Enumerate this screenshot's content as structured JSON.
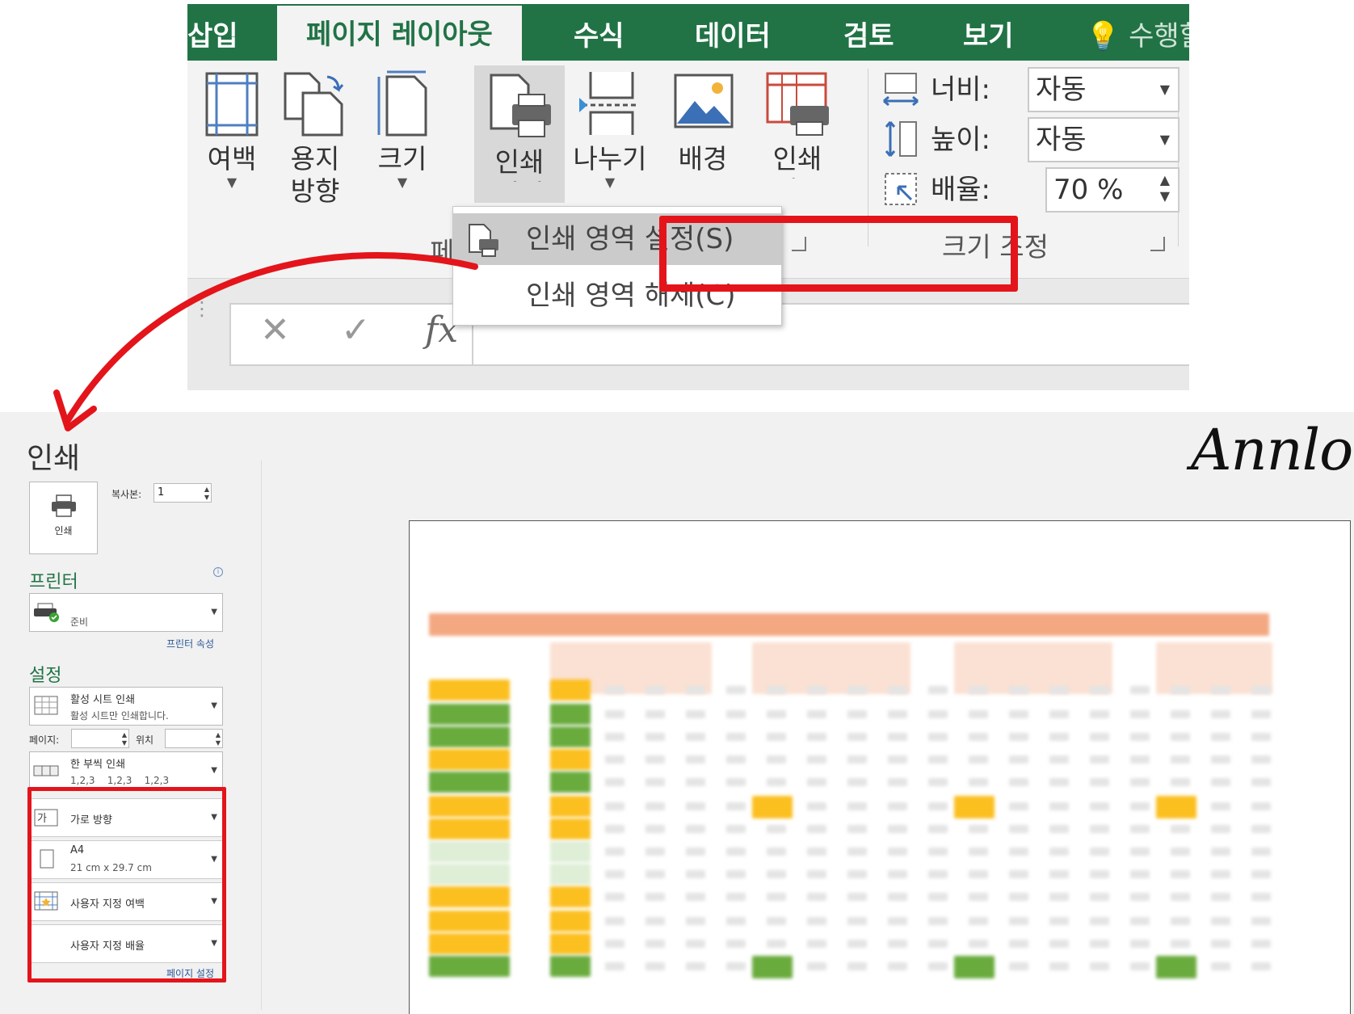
{
  "ribbon": {
    "tabs": [
      "삽입",
      "페이지 레이아웃",
      "수식",
      "데이터",
      "검토",
      "보기",
      "수행할"
    ],
    "active_tab": "페이지 레이아웃",
    "buttons": {
      "margins": "여백",
      "orientation": "용지\n방향",
      "size": "크기",
      "print_area": "인쇄\n영역",
      "breaks": "나누기",
      "background": "배경",
      "print_titles": "인쇄\n제목"
    },
    "page_setup_group": "페이",
    "scale_group": {
      "label": "크기 조정",
      "width_label": "너비:",
      "width_value": "자동",
      "height_label": "높이:",
      "height_value": "자동",
      "scale_label": "배율:",
      "scale_value": "70 %"
    },
    "dropdown": {
      "set_print_area": "인쇄 영역 설정(S)",
      "clear_print_area": "인쇄 영역 해제(C)"
    },
    "formula_bar": {
      "cancel": "✕",
      "enter": "✓",
      "fx": "fx"
    }
  },
  "backstage": {
    "title": "인쇄",
    "watermark": "Annlog",
    "print_button": "인쇄",
    "copies_label": "복사본:",
    "copies_value": "1",
    "printer_header": "프린터",
    "printer_status": "준비",
    "printer_properties": "프린터 속성",
    "settings_header": "설정",
    "settings": {
      "print_what": {
        "title": "활성 시트 인쇄",
        "sub": "활성 시트만 인쇄합니다."
      },
      "pages_label": "페이지:",
      "to_label": "위치",
      "collate": {
        "title": "한 부씩 인쇄",
        "sub": "1,2,3    1,2,3    1,2,3"
      },
      "orientation": {
        "title": "가로 방향"
      },
      "paper": {
        "title": "A4",
        "sub": "21 cm x 29.7 cm"
      },
      "margins": {
        "title": "사용자 지정 여백"
      },
      "scaling": {
        "title": "사용자 지정 배율"
      },
      "page_setup_link": "페이지 설정"
    }
  },
  "colors": {
    "excel_green": "#217346",
    "highlight_red": "#e4141b",
    "cell_orange": "#fbbf1f",
    "cell_green": "#6aab3e",
    "header_salmon": "#f3a882",
    "header_light": "#fbe1d3"
  }
}
